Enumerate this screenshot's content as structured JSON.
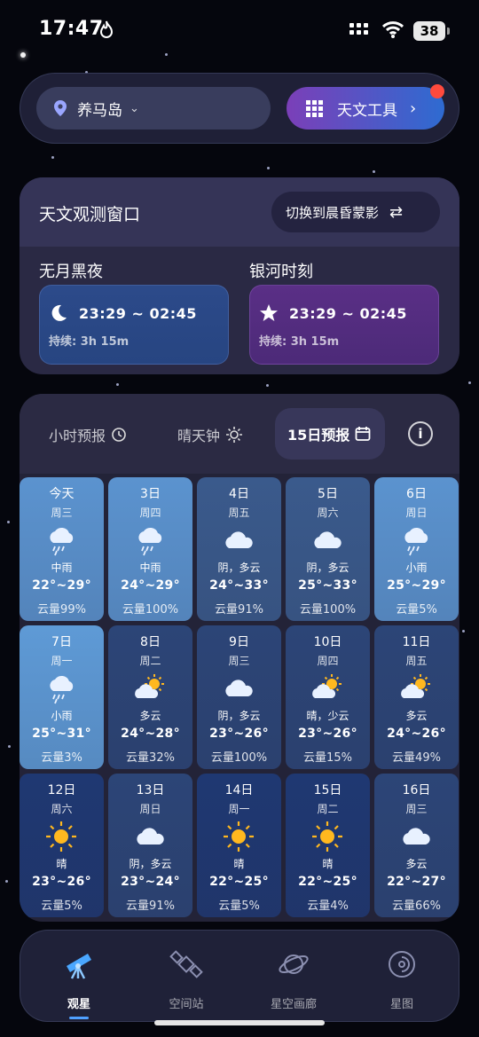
{
  "status": {
    "time": "17:47",
    "battery": "38"
  },
  "header": {
    "location": "养马岛",
    "tools_label": "天文工具"
  },
  "observation": {
    "title": "天文观测窗口",
    "switch_label": "切换到晨昏蒙影",
    "moonless": {
      "title": "无月黑夜",
      "range": "23:29 ~ 02:45",
      "duration": "持续: 3h 15m"
    },
    "galaxy": {
      "title": "银河时刻",
      "range": "23:29 ~ 02:45",
      "duration": "持续: 3h 15m"
    }
  },
  "forecast": {
    "tabs": [
      {
        "label": "小时预报",
        "icon": "clock-icon"
      },
      {
        "label": "晴天钟",
        "icon": "sun-icon"
      },
      {
        "label": "15日预报",
        "icon": "calendar-icon"
      }
    ],
    "active_tab": "15日预报",
    "days": [
      {
        "date": "今天",
        "weekday": "周三",
        "icon": "rain",
        "condition": "中雨",
        "temp": "22°~29°",
        "cloud": "云量99%",
        "color": "#5b93cf"
      },
      {
        "date": "3日",
        "weekday": "周四",
        "icon": "rain",
        "condition": "中雨",
        "temp": "24°~29°",
        "cloud": "云量100%",
        "color": "#5b93cf"
      },
      {
        "date": "4日",
        "weekday": "周五",
        "icon": "cloud",
        "condition": "阴，多云",
        "temp": "24°~33°",
        "cloud": "云量91%",
        "color": "#3a5a8c"
      },
      {
        "date": "5日",
        "weekday": "周六",
        "icon": "cloud",
        "condition": "阴，多云",
        "temp": "25°~33°",
        "cloud": "云量100%",
        "color": "#3a5a8c"
      },
      {
        "date": "6日",
        "weekday": "周日",
        "icon": "rain",
        "condition": "小雨",
        "temp": "25°~29°",
        "cloud": "云量5%",
        "color": "#5b93cf"
      },
      {
        "date": "7日",
        "weekday": "周一",
        "icon": "rain",
        "condition": "小雨",
        "temp": "25°~31°",
        "cloud": "云量3%",
        "color": "#5e9ad6"
      },
      {
        "date": "8日",
        "weekday": "周二",
        "icon": "partly",
        "condition": "多云",
        "temp": "24°~28°",
        "cloud": "云量32%",
        "color": "#2c4577"
      },
      {
        "date": "9日",
        "weekday": "周三",
        "icon": "cloud",
        "condition": "阴，多云",
        "temp": "23°~26°",
        "cloud": "云量100%",
        "color": "#2c4577"
      },
      {
        "date": "10日",
        "weekday": "周四",
        "icon": "partly",
        "condition": "晴，少云",
        "temp": "23°~26°",
        "cloud": "云量15%",
        "color": "#2c4577"
      },
      {
        "date": "11日",
        "weekday": "周五",
        "icon": "partly",
        "condition": "多云",
        "temp": "24°~26°",
        "cloud": "云量49%",
        "color": "#2c4577"
      },
      {
        "date": "12日",
        "weekday": "周六",
        "icon": "sun",
        "condition": "晴",
        "temp": "23°~26°",
        "cloud": "云量5%",
        "color": "#1f3872"
      },
      {
        "date": "13日",
        "weekday": "周日",
        "icon": "cloud",
        "condition": "阴，多云",
        "temp": "23°~24°",
        "cloud": "云量91%",
        "color": "#2c4577"
      },
      {
        "date": "14日",
        "weekday": "周一",
        "icon": "sun",
        "condition": "晴",
        "temp": "22°~25°",
        "cloud": "云量5%",
        "color": "#1f3872"
      },
      {
        "date": "15日",
        "weekday": "周二",
        "icon": "sun",
        "condition": "晴",
        "temp": "22°~25°",
        "cloud": "云量4%",
        "color": "#1f3872"
      },
      {
        "date": "16日",
        "weekday": "周三",
        "icon": "cloud",
        "condition": "多云",
        "temp": "22°~27°",
        "cloud": "云量66%",
        "color": "#2c4577"
      }
    ]
  },
  "nav": {
    "items": [
      {
        "label": "观星",
        "icon": "telescope-icon",
        "active": true
      },
      {
        "label": "空间站",
        "icon": "satellite-icon",
        "active": false
      },
      {
        "label": "星空画廊",
        "icon": "planet-icon",
        "active": false
      },
      {
        "label": "星图",
        "icon": "galaxy-icon",
        "active": false
      }
    ]
  }
}
